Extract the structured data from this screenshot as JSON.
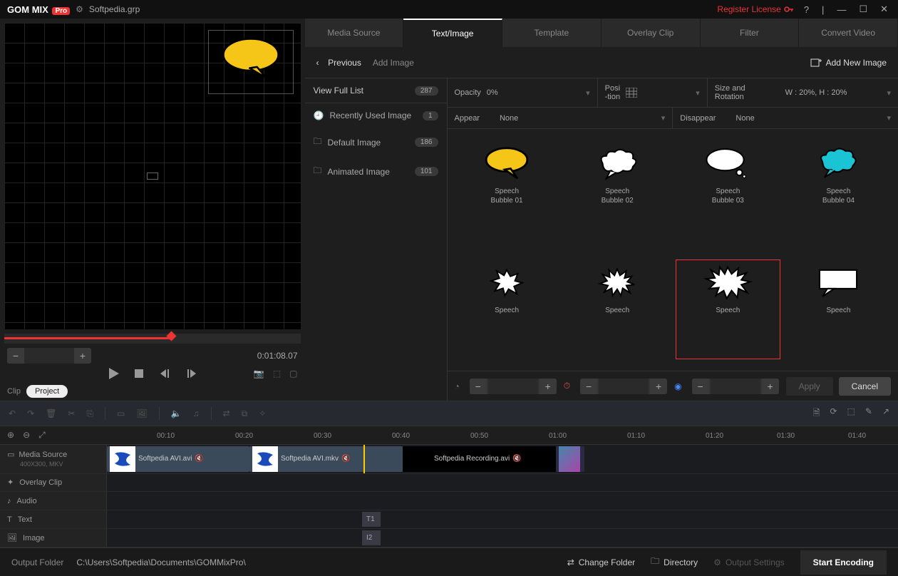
{
  "title": {
    "brand1": "GOM",
    "brand2": "MIX",
    "pro": "Pro",
    "file": "Softpedia.grp",
    "register": "Register License"
  },
  "preview": {
    "timecode": "0:01:08.07",
    "clip": "Clip",
    "project": "Project"
  },
  "tabs": [
    "Media Source",
    "Text/Image",
    "Template",
    "Overlay Clip",
    "Filter",
    "Convert Video"
  ],
  "subheader": {
    "previous": "Previous",
    "addImage": "Add Image",
    "addNew": "Add New Image"
  },
  "categories": {
    "viewFull": "View Full List",
    "viewFullCount": "287",
    "items": [
      {
        "label": "Recently Used Image",
        "count": "1"
      },
      {
        "label": "Default Image",
        "count": "186"
      },
      {
        "label": "Animated Image",
        "count": "101"
      }
    ]
  },
  "props": {
    "opacity": "Opacity",
    "opacityVal": "0%",
    "position": "Posi\n-tion",
    "sizeRot": "Size and\nRotation",
    "sizeRotVal": "W : 20%, H : 20%",
    "appear": "Appear",
    "appearVal": "None",
    "disappear": "Disappear",
    "disappearVal": "None"
  },
  "thumbs": [
    {
      "label": "Speech\nBubble 01"
    },
    {
      "label": "Speech\nBubble 02"
    },
    {
      "label": "Speech\nBubble 03"
    },
    {
      "label": "Speech\nBubble 04"
    },
    {
      "label": "Speech"
    },
    {
      "label": "Speech"
    },
    {
      "label": "Speech"
    },
    {
      "label": "Speech"
    }
  ],
  "buttons": {
    "apply": "Apply",
    "cancel": "Cancel"
  },
  "ruler": [
    "00:10",
    "00:20",
    "00:30",
    "00:40",
    "00:50",
    "01:00",
    "01:10",
    "01:20",
    "01:30",
    "01:40"
  ],
  "tracks": {
    "media": {
      "label": "Media Source",
      "sub": "400X300, MKV"
    },
    "overlay": "Overlay Clip",
    "audio": "Audio",
    "text": "Text",
    "image": "Image",
    "t1": "T1",
    "i2": "I2"
  },
  "clips": [
    {
      "label": "Softpedia AVI.avi"
    },
    {
      "label": "Softpedia AVI.mkv"
    },
    {
      "label": "Softpedia Recording.avi"
    }
  ],
  "footer": {
    "outputFolder": "Output Folder",
    "path": "C:\\Users\\Softpedia\\Documents\\GOMMixPro\\",
    "changeFolder": "Change Folder",
    "directory": "Directory",
    "outputSettings": "Output Settings",
    "startEncoding": "Start Encoding"
  }
}
